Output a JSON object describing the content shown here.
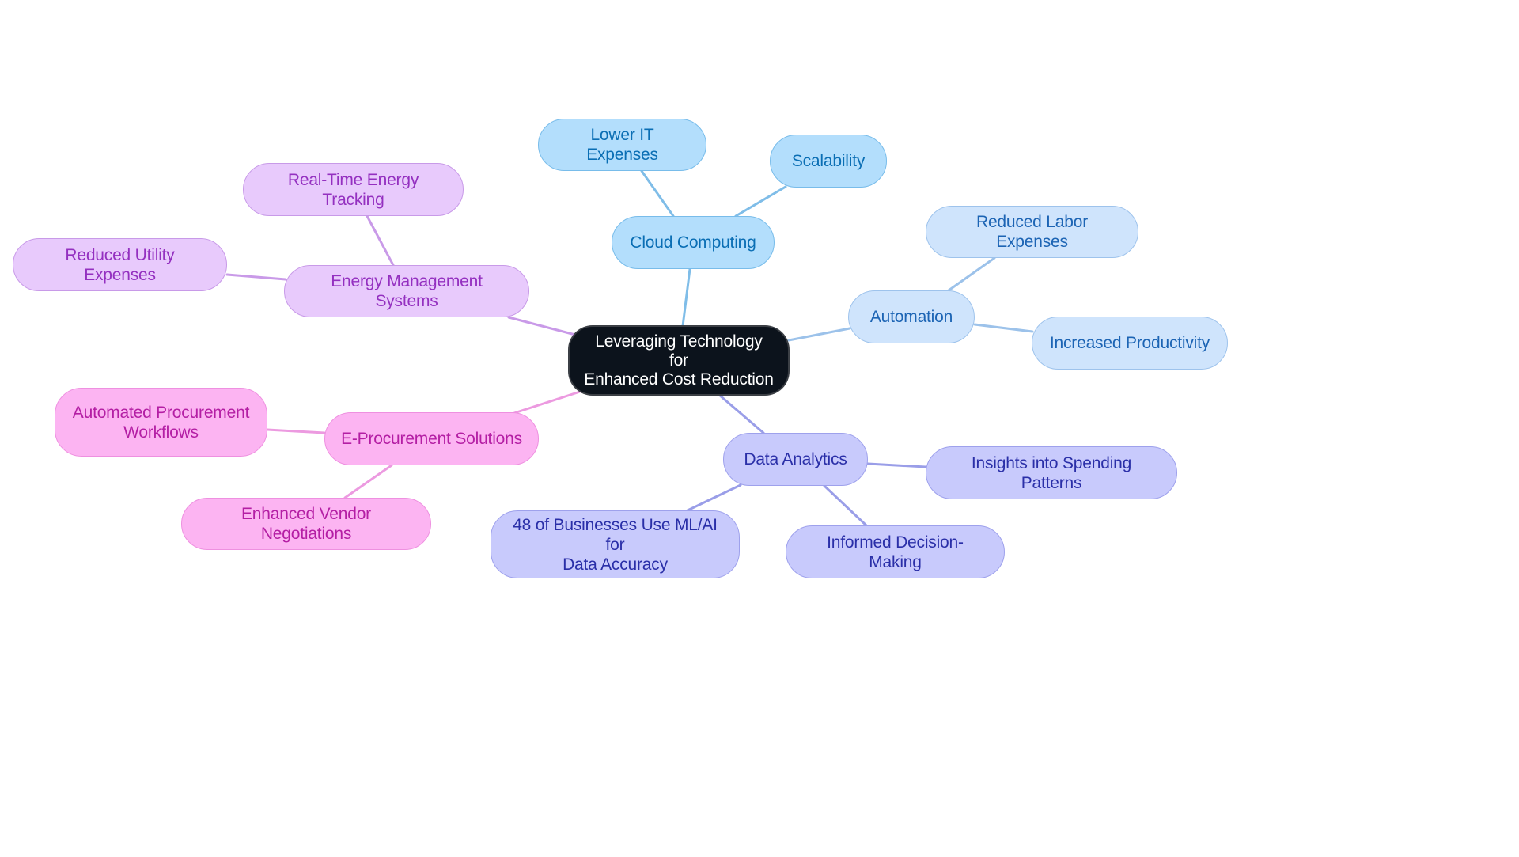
{
  "diagram": {
    "type": "mindmap",
    "title": "Leveraging Technology for Enhanced Cost Reduction",
    "colors": {
      "background": "#ffffff",
      "root": {
        "fill": "#0c131c",
        "stroke": "#3b3f45",
        "text": "#ffffff"
      },
      "cloud": {
        "fill": "#b3defc",
        "stroke": "#78bcea",
        "text": "#0a6eb4",
        "edge": "#7fbde8"
      },
      "automation": {
        "fill": "#cfe4fc",
        "stroke": "#9ec3ec",
        "text": "#1c64b4",
        "edge": "#9cc2ea"
      },
      "analytics": {
        "fill": "#c8cafc",
        "stroke": "#9ea1ec",
        "text": "#2a2fa8",
        "edge": "#9a9ee8"
      },
      "procurement": {
        "fill": "#fcb4f2",
        "stroke": "#ee90e0",
        "text": "#b41ea4",
        "edge": "#ec9ae0"
      },
      "energy": {
        "fill": "#e8cafc",
        "stroke": "#c89ae8",
        "text": "#9430c0",
        "edge": "#c99ae8"
      }
    },
    "root": {
      "id": "root",
      "label": "Leveraging Technology for\nEnhanced Cost Reduction"
    },
    "branches": [
      {
        "id": "cloud",
        "label": "Cloud Computing",
        "theme": "cloud",
        "children": [
          {
            "id": "cloud-lower-it",
            "label": "Lower IT Expenses"
          },
          {
            "id": "cloud-scalability",
            "label": "Scalability"
          }
        ]
      },
      {
        "id": "automation",
        "label": "Automation",
        "theme": "automation",
        "children": [
          {
            "id": "auto-labor",
            "label": "Reduced Labor Expenses"
          },
          {
            "id": "auto-productivity",
            "label": "Increased Productivity"
          }
        ]
      },
      {
        "id": "analytics",
        "label": "Data Analytics",
        "theme": "analytics",
        "children": [
          {
            "id": "da-insights",
            "label": "Insights into Spending Patterns"
          },
          {
            "id": "da-decision",
            "label": "Informed Decision-Making"
          },
          {
            "id": "da-ml",
            "label": "48 of Businesses Use ML/AI for\nData Accuracy"
          }
        ]
      },
      {
        "id": "procurement",
        "label": "E-Procurement Solutions",
        "theme": "procurement",
        "children": [
          {
            "id": "ep-workflows",
            "label": "Automated Procurement\nWorkflows"
          },
          {
            "id": "ep-vendor",
            "label": "Enhanced Vendor Negotiations"
          }
        ]
      },
      {
        "id": "energy",
        "label": "Energy Management Systems",
        "theme": "energy",
        "children": [
          {
            "id": "em-tracking",
            "label": "Real-Time Energy Tracking"
          },
          {
            "id": "em-utility",
            "label": "Reduced Utility Expenses"
          }
        ]
      }
    ]
  }
}
